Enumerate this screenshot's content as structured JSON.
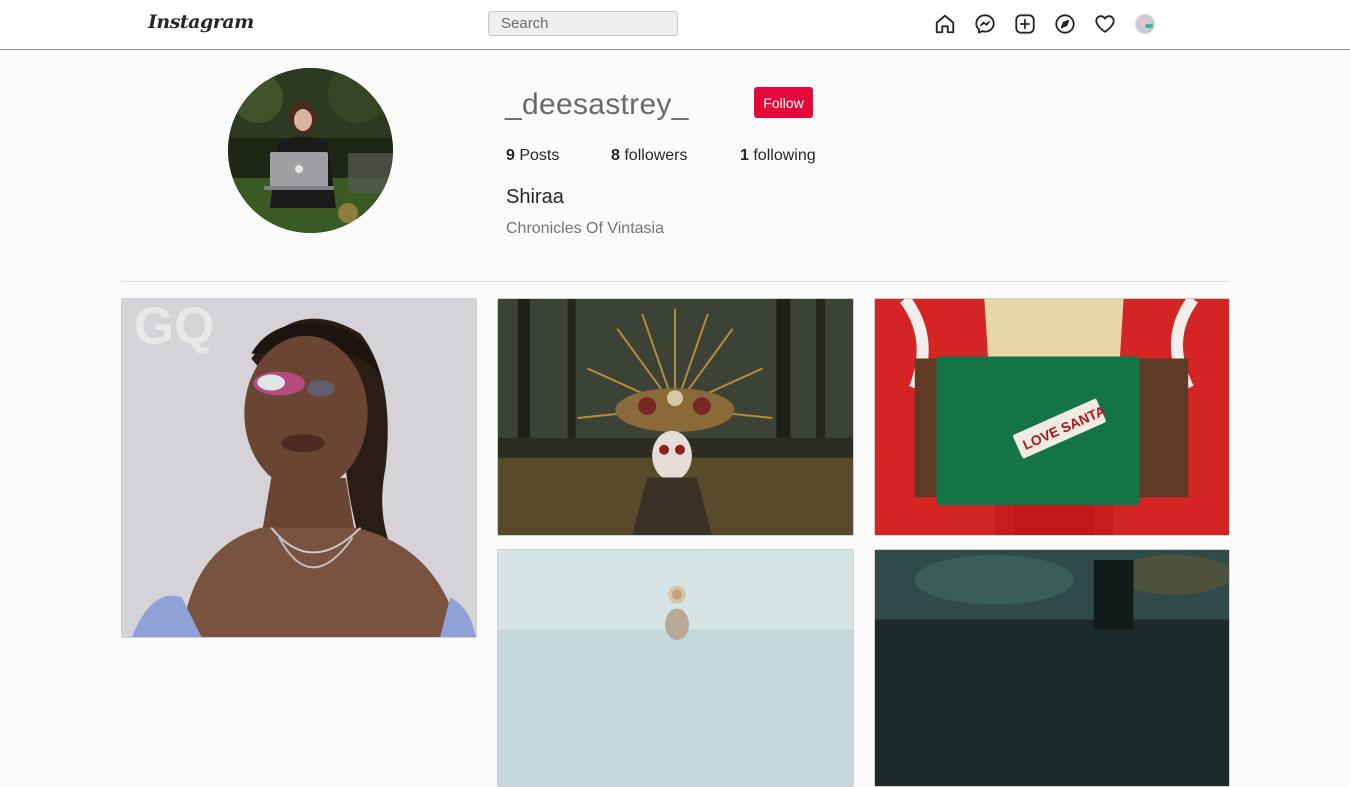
{
  "nav": {
    "logo": "Instagram",
    "search_placeholder": "Search",
    "icons": [
      "home-icon",
      "messenger-icon",
      "new-post-icon",
      "explore-icon",
      "activity-heart-icon",
      "profile-avatar"
    ]
  },
  "profile": {
    "username": "_deesastrey_",
    "follow_label": "Follow",
    "posts_count": "9",
    "posts_label": "Posts",
    "followers_count": "8",
    "followers_label": "followers",
    "following_count": "1",
    "following_label": "following",
    "full_name": "Shiraa",
    "bio": "Chronicles Of Vintasia"
  },
  "posts": [
    {
      "watermark": "GQ"
    },
    {},
    {
      "tag": "LOVE SANTA"
    },
    {},
    {}
  ],
  "colors": {
    "follow_button": "#e3093a",
    "background": "#fafafa"
  }
}
